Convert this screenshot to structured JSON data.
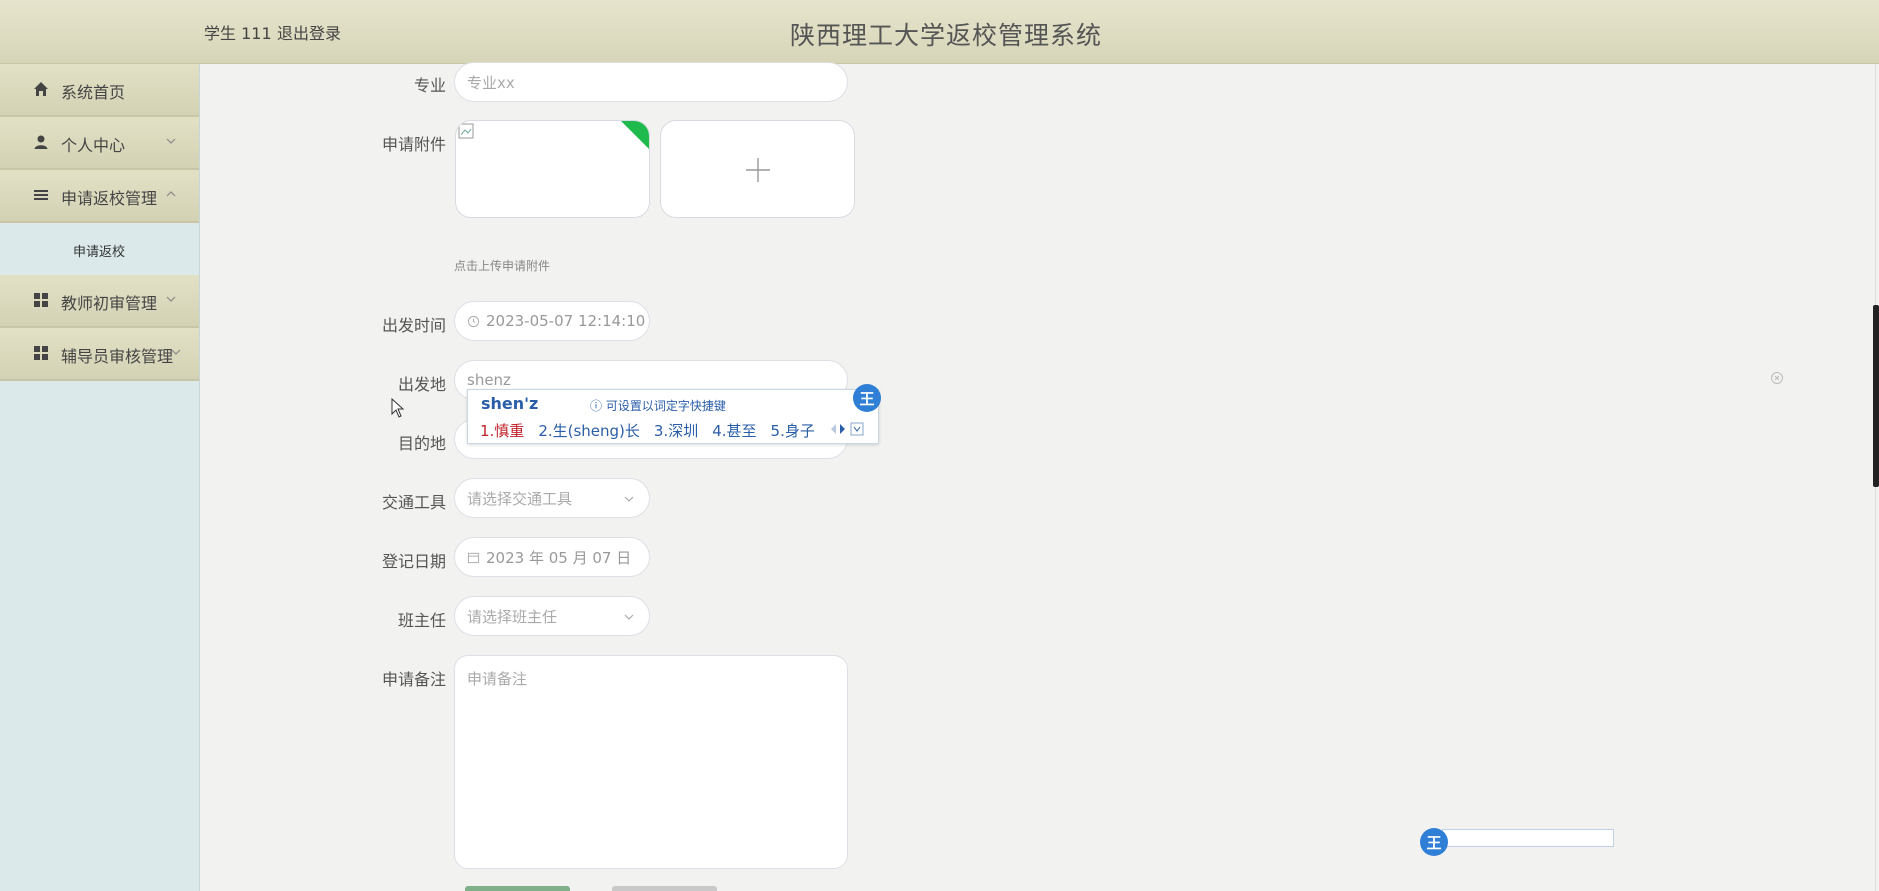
{
  "header": {
    "user": "学生 111",
    "logout": "退出登录",
    "title": "陕西理工大学返校管理系统"
  },
  "sidebar": {
    "items": [
      {
        "label": "系统首页",
        "icon": "home-icon"
      },
      {
        "label": "个人中心",
        "icon": "user-icon"
      },
      {
        "label": "申请返校管理",
        "icon": "list-icon"
      },
      {
        "label": "教师初审管理",
        "icon": "grid-icon"
      },
      {
        "label": "辅导员审核管理",
        "icon": "grid-icon"
      }
    ],
    "sub_item": "申请返校"
  },
  "form": {
    "major": {
      "label": "专业",
      "placeholder": "专业xx"
    },
    "attachment": {
      "label": "申请附件",
      "tip": "点击上传申请附件"
    },
    "depart_time": {
      "label": "出发时间",
      "value": "2023-05-07 12:14:10"
    },
    "origin": {
      "label": "出发地",
      "value": "shenz"
    },
    "destination": {
      "label": "目的地"
    },
    "transport": {
      "label": "交通工具",
      "placeholder": "请选择交通工具"
    },
    "register_date": {
      "label": "登记日期",
      "value": "2023 年 05 月 07 日"
    },
    "head_teacher": {
      "label": "班主任",
      "placeholder": "请选择班主任"
    },
    "remark": {
      "label": "申请备注",
      "placeholder": "申请备注"
    }
  },
  "ime": {
    "composition": "shen'z",
    "hint": "ⓘ 可设置以词定字快捷键",
    "candidates": [
      "1.慎重",
      "2.生(sheng)长",
      "3.深圳",
      "4.甚至",
      "5.身子"
    ],
    "badge": "王"
  },
  "colors": {
    "header_bg": "#e6e4cc",
    "sidebar_bg": "#dbe9ea",
    "ime_blue": "#2a5ea8",
    "ime_red": "#c0222a",
    "badge_blue": "#2f7fd6"
  }
}
